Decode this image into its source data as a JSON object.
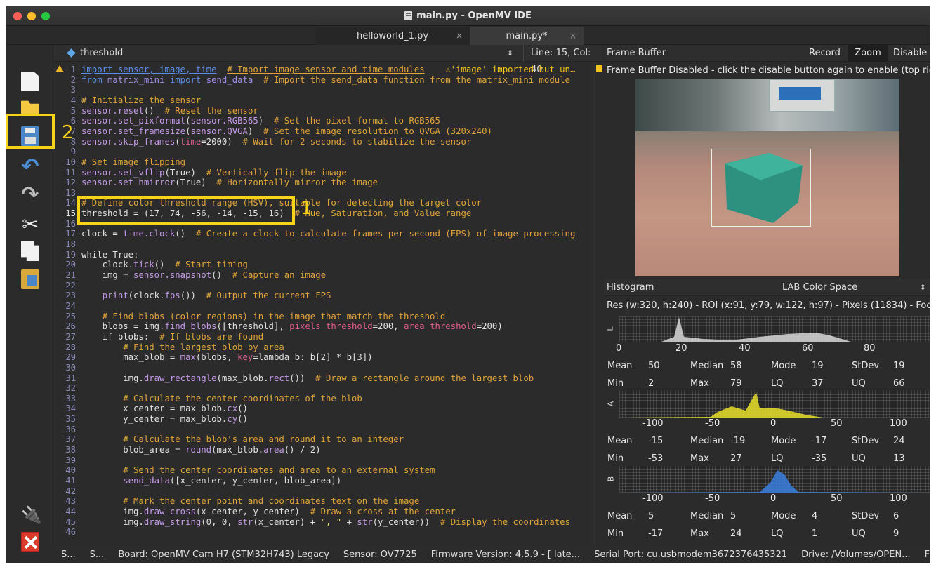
{
  "window": {
    "title": "main.py - OpenMV IDE"
  },
  "tabs": [
    {
      "label": "helloworld_1.py",
      "close": "×"
    },
    {
      "label": "main.py*",
      "close": "×"
    }
  ],
  "editor": {
    "symbol": "threshold",
    "cursor_pos": "Line: 15, Col: 40",
    "annotation_1": "1",
    "lines": [
      {
        "n": "1",
        "segs": [
          {
            "t": "import sensor, image, time",
            "c": "#5c8ee8",
            "u": true
          },
          {
            "t": "  ",
            "c": "#e0e0e0"
          },
          {
            "t": "# Import image sensor and time modules",
            "c": "#e0a43a",
            "u": true
          },
          {
            "t": "    ",
            "c": "#e0e0e0"
          },
          {
            "t": "⚠'image' imported but un…",
            "c": "#f0c419"
          }
        ]
      },
      {
        "n": "2",
        "segs": [
          {
            "t": "from ",
            "c": "#5c8ee8"
          },
          {
            "t": "matrix_mini ",
            "c": "#a08ee8"
          },
          {
            "t": "import ",
            "c": "#5c8ee8"
          },
          {
            "t": "send_data",
            "c": "#a08ee8"
          },
          {
            "t": "  # Import the send_data function from the matrix_mini module",
            "c": "#e0a43a"
          }
        ]
      },
      {
        "n": "3",
        "segs": []
      },
      {
        "n": "4",
        "segs": [
          {
            "t": "# Initialize the sensor",
            "c": "#e0a43a"
          }
        ]
      },
      {
        "n": "5",
        "segs": [
          {
            "t": "sensor.",
            "c": "#c59ae8"
          },
          {
            "t": "reset",
            "c": "#c59ae8"
          },
          {
            "t": "()  ",
            "c": "#e0e0e0"
          },
          {
            "t": "# Reset the sensor",
            "c": "#e0a43a"
          }
        ]
      },
      {
        "n": "6",
        "segs": [
          {
            "t": "sensor.set_pixformat",
            "c": "#c59ae8"
          },
          {
            "t": "(",
            "c": "#e0e0e0"
          },
          {
            "t": "sensor.RGB565",
            "c": "#c59ae8"
          },
          {
            "t": ")  ",
            "c": "#e0e0e0"
          },
          {
            "t": "# Set the pixel format to RGB565",
            "c": "#e0a43a"
          }
        ]
      },
      {
        "n": "7",
        "segs": [
          {
            "t": "sensor.set_framesize",
            "c": "#c59ae8"
          },
          {
            "t": "(",
            "c": "#e0e0e0"
          },
          {
            "t": "sensor.QVGA",
            "c": "#c59ae8"
          },
          {
            "t": ")  ",
            "c": "#e0e0e0"
          },
          {
            "t": "# Set the image resolution to QVGA (320x240)",
            "c": "#e0a43a"
          }
        ]
      },
      {
        "n": "8",
        "segs": [
          {
            "t": "sensor.skip_frames",
            "c": "#c59ae8"
          },
          {
            "t": "(",
            "c": "#e0e0e0"
          },
          {
            "t": "time",
            "c": "#e05c8e"
          },
          {
            "t": "=2000)  ",
            "c": "#e0e0e0"
          },
          {
            "t": "# Wait for 2 seconds to stabilize the sensor",
            "c": "#e0a43a"
          }
        ]
      },
      {
        "n": "9",
        "segs": []
      },
      {
        "n": "10",
        "segs": [
          {
            "t": "# Set image flipping",
            "c": "#e0a43a"
          }
        ]
      },
      {
        "n": "11",
        "segs": [
          {
            "t": "sensor.set_vflip",
            "c": "#c59ae8"
          },
          {
            "t": "(True)  ",
            "c": "#e0e0e0"
          },
          {
            "t": "# Vertically flip the image",
            "c": "#e0a43a"
          }
        ]
      },
      {
        "n": "12",
        "segs": [
          {
            "t": "sensor.set_hmirror",
            "c": "#c59ae8"
          },
          {
            "t": "(True)  ",
            "c": "#e0e0e0"
          },
          {
            "t": "# Horizontally mirror the image",
            "c": "#e0a43a"
          }
        ]
      },
      {
        "n": "13",
        "segs": []
      },
      {
        "n": "14",
        "segs": [
          {
            "t": "# Define color threshold range (HSV), suitable for detecting the target color",
            "c": "#e0a43a"
          }
        ]
      },
      {
        "n": "15",
        "cur": true,
        "segs": [
          {
            "t": "threshold = (17, 74, -56, -14, -15, 16)  ",
            "c": "#e0e0e0"
          },
          {
            "t": "# Hue, Saturation, and Value range",
            "c": "#e0a43a"
          }
        ]
      },
      {
        "n": "16",
        "segs": []
      },
      {
        "n": "17",
        "segs": [
          {
            "t": "clock = ",
            "c": "#e0e0e0"
          },
          {
            "t": "time.clock",
            "c": "#c59ae8"
          },
          {
            "t": "()  ",
            "c": "#e0e0e0"
          },
          {
            "t": "# Create a clock to calculate frames per second (FPS) of image processing",
            "c": "#e0a43a"
          }
        ]
      },
      {
        "n": "18",
        "segs": []
      },
      {
        "n": "19",
        "segs": [
          {
            "t": "while True:",
            "c": "#e0e0e0"
          }
        ]
      },
      {
        "n": "20",
        "segs": [
          {
            "t": "    clock.",
            "c": "#e0e0e0"
          },
          {
            "t": "tick",
            "c": "#c59ae8"
          },
          {
            "t": "()  ",
            "c": "#e0e0e0"
          },
          {
            "t": "# Start timing",
            "c": "#e0a43a"
          }
        ]
      },
      {
        "n": "21",
        "segs": [
          {
            "t": "    img = ",
            "c": "#e0e0e0"
          },
          {
            "t": "sensor.snapshot",
            "c": "#c59ae8"
          },
          {
            "t": "()  ",
            "c": "#e0e0e0"
          },
          {
            "t": "# Capture an image",
            "c": "#e0a43a"
          }
        ]
      },
      {
        "n": "22",
        "segs": []
      },
      {
        "n": "23",
        "segs": [
          {
            "t": "    ",
            "c": "#e0e0e0"
          },
          {
            "t": "print",
            "c": "#c59ae8"
          },
          {
            "t": "(clock.",
            "c": "#e0e0e0"
          },
          {
            "t": "fps",
            "c": "#c59ae8"
          },
          {
            "t": "())  ",
            "c": "#e0e0e0"
          },
          {
            "t": "# Output the current FPS",
            "c": "#e0a43a"
          }
        ]
      },
      {
        "n": "24",
        "segs": []
      },
      {
        "n": "25",
        "segs": [
          {
            "t": "    # Find blobs (color regions) in the image that match the threshold",
            "c": "#e0a43a"
          }
        ]
      },
      {
        "n": "26",
        "segs": [
          {
            "t": "    blobs = img.",
            "c": "#e0e0e0"
          },
          {
            "t": "find_blobs",
            "c": "#c59ae8"
          },
          {
            "t": "([threshold], ",
            "c": "#e0e0e0"
          },
          {
            "t": "pixels_threshold",
            "c": "#e05c8e"
          },
          {
            "t": "=200, ",
            "c": "#e0e0e0"
          },
          {
            "t": "area_threshold",
            "c": "#e05c8e"
          },
          {
            "t": "=200)",
            "c": "#e0e0e0"
          }
        ]
      },
      {
        "n": "27",
        "segs": [
          {
            "t": "    if blobs:  ",
            "c": "#e0e0e0"
          },
          {
            "t": "# If blobs are found",
            "c": "#e0a43a"
          }
        ]
      },
      {
        "n": "28",
        "segs": [
          {
            "t": "        # Find the largest blob by area",
            "c": "#e0a43a"
          }
        ]
      },
      {
        "n": "29",
        "segs": [
          {
            "t": "        max_blob = ",
            "c": "#e0e0e0"
          },
          {
            "t": "max",
            "c": "#c59ae8"
          },
          {
            "t": "(blobs, ",
            "c": "#e0e0e0"
          },
          {
            "t": "key",
            "c": "#e05c8e"
          },
          {
            "t": "=lambda b: b[2] * b[3])",
            "c": "#e0e0e0"
          }
        ]
      },
      {
        "n": "30",
        "segs": []
      },
      {
        "n": "31",
        "segs": [
          {
            "t": "        img.",
            "c": "#e0e0e0"
          },
          {
            "t": "draw_rectangle",
            "c": "#c59ae8"
          },
          {
            "t": "(max_blob.",
            "c": "#e0e0e0"
          },
          {
            "t": "rect",
            "c": "#c59ae8"
          },
          {
            "t": "())  ",
            "c": "#e0e0e0"
          },
          {
            "t": "# Draw a rectangle around the largest blob",
            "c": "#e0a43a"
          }
        ]
      },
      {
        "n": "32",
        "segs": []
      },
      {
        "n": "33",
        "segs": [
          {
            "t": "        # Calculate the center coordinates of the blob",
            "c": "#e0a43a"
          }
        ]
      },
      {
        "n": "34",
        "segs": [
          {
            "t": "        x_center = max_blob.",
            "c": "#e0e0e0"
          },
          {
            "t": "cx",
            "c": "#c59ae8"
          },
          {
            "t": "()",
            "c": "#e0e0e0"
          }
        ]
      },
      {
        "n": "35",
        "segs": [
          {
            "t": "        y_center = max_blob.",
            "c": "#e0e0e0"
          },
          {
            "t": "cy",
            "c": "#c59ae8"
          },
          {
            "t": "()",
            "c": "#e0e0e0"
          }
        ]
      },
      {
        "n": "36",
        "segs": []
      },
      {
        "n": "37",
        "segs": [
          {
            "t": "        # Calculate the blob's area and round it to an integer",
            "c": "#e0a43a"
          }
        ]
      },
      {
        "n": "38",
        "segs": [
          {
            "t": "        blob_area = ",
            "c": "#e0e0e0"
          },
          {
            "t": "round",
            "c": "#c59ae8"
          },
          {
            "t": "(max_blob.",
            "c": "#e0e0e0"
          },
          {
            "t": "area",
            "c": "#c59ae8"
          },
          {
            "t": "() / 2)",
            "c": "#e0e0e0"
          }
        ]
      },
      {
        "n": "39",
        "segs": []
      },
      {
        "n": "40",
        "segs": [
          {
            "t": "        # Send the center coordinates and area to an external system",
            "c": "#e0a43a"
          }
        ]
      },
      {
        "n": "41",
        "segs": [
          {
            "t": "        ",
            "c": "#e0e0e0"
          },
          {
            "t": "send_data",
            "c": "#c59ae8"
          },
          {
            "t": "([x_center, y_center, blob_area])",
            "c": "#e0e0e0"
          }
        ]
      },
      {
        "n": "42",
        "segs": []
      },
      {
        "n": "43",
        "segs": [
          {
            "t": "        # Mark the center point and coordinates text on the image",
            "c": "#e0a43a"
          }
        ]
      },
      {
        "n": "44",
        "segs": [
          {
            "t": "        img.",
            "c": "#e0e0e0"
          },
          {
            "t": "draw_cross",
            "c": "#c59ae8"
          },
          {
            "t": "(x_center, y_center)  ",
            "c": "#e0e0e0"
          },
          {
            "t": "# Draw a cross at the center",
            "c": "#e0a43a"
          }
        ]
      },
      {
        "n": "45",
        "segs": [
          {
            "t": "        img.",
            "c": "#e0e0e0"
          },
          {
            "t": "draw_string",
            "c": "#c59ae8"
          },
          {
            "t": "(0, 0, ",
            "c": "#e0e0e0"
          },
          {
            "t": "str",
            "c": "#c59ae8"
          },
          {
            "t": "(x_center) + ",
            "c": "#e0e0e0"
          },
          {
            "t": "\", \"",
            "c": "#e8e070"
          },
          {
            "t": " + ",
            "c": "#e0e0e0"
          },
          {
            "t": "str",
            "c": "#c59ae8"
          },
          {
            "t": "(y_center))  ",
            "c": "#e0e0e0"
          },
          {
            "t": "# Display the coordinates",
            "c": "#e0a43a"
          }
        ]
      },
      {
        "n": "46",
        "segs": []
      }
    ]
  },
  "toolbar": {
    "annotation_2": "2"
  },
  "framebuffer": {
    "title": "Frame Buffer",
    "record": "Record",
    "zoom": "Zoom",
    "disable": "Disable",
    "message": "Frame Buffer Disabled - click the disable button again to enable (top rig…"
  },
  "histogram": {
    "title": "Histogram",
    "color_space": "LAB Color Space",
    "info": "Res (w:320, h:240) - ROI (x:91, y:79, w:122, h:97) - Pixels (11834) - Foc…",
    "channels": [
      {
        "axis": "L",
        "ticks": [
          "0",
          "20",
          "40",
          "60",
          "80"
        ],
        "stats": {
          "mean_label": "Mean",
          "mean": "50",
          "median_label": "Median",
          "median": "58",
          "mode_label": "Mode",
          "mode": "19",
          "stdev_label": "StDev",
          "stdev": "19",
          "min_label": "Min",
          "min": "2",
          "max_label": "Max",
          "max": "79",
          "lq_label": "LQ",
          "lq": "37",
          "uq_label": "UQ",
          "uq": "66"
        }
      },
      {
        "axis": "A",
        "ticks": [
          "-100",
          "-50",
          "0",
          "50",
          "100"
        ],
        "stats": {
          "mean_label": "Mean",
          "mean": "-15",
          "median_label": "Median",
          "median": "-19",
          "mode_label": "Mode",
          "mode": "-17",
          "stdev_label": "StDev",
          "stdev": "24",
          "min_label": "Min",
          "min": "-53",
          "max_label": "Max",
          "max": "27",
          "lq_label": "LQ",
          "lq": "-35",
          "uq_label": "UQ",
          "uq": "13"
        }
      },
      {
        "axis": "B",
        "ticks": [
          "-100",
          "-50",
          "0",
          "50",
          "100"
        ],
        "stats": {
          "mean_label": "Mean",
          "mean": "5",
          "median_label": "Median",
          "median": "5",
          "mode_label": "Mode",
          "mode": "4",
          "stdev_label": "StDev",
          "stdev": "6",
          "min_label": "Min",
          "min": "-17",
          "max_label": "Max",
          "max": "24",
          "lq_label": "LQ",
          "lq": "1",
          "uq_label": "UQ",
          "uq": "9"
        }
      }
    ]
  },
  "statusbar": {
    "s1": "S...",
    "s2": "S...",
    "board": "Board: OpenMV Cam H7 (STM32H743) Legacy",
    "sensor": "Sensor: OV7725",
    "firmware": "Firmware Version: 4.5.9 - [ late...",
    "port": "Serial Port: cu.usbmodem3672376435321",
    "drive": "Drive: /Volumes/OPEN...",
    "fps": "FP..."
  },
  "colors": {
    "accent_yellow": "#f7d31a",
    "bg": "#2b2b2b"
  }
}
